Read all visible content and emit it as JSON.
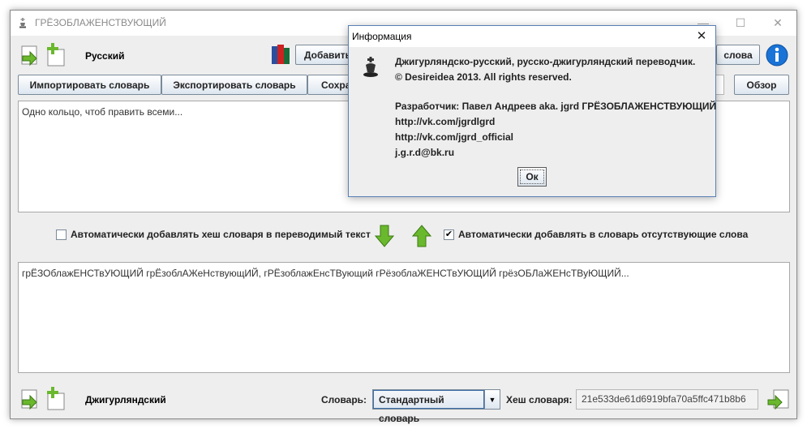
{
  "window": {
    "title": "ГРЁЗОБЛАЖЕНСТВУЮЩИЙ",
    "min_glyph": "—",
    "max_glyph": "☐",
    "close_glyph": "✕"
  },
  "top": {
    "source_language": "Русский",
    "add_button_label": "Добавить",
    "words_button_label": "слова",
    "import_label": "Импортировать словарь",
    "export_label": "Экспортировать словарь",
    "save_label": "Сохра",
    "browse_label": "Обзор"
  },
  "source_text": "Одно кольцо, чтоб править всеми...",
  "middle": {
    "auto_hash_label": "Автоматически добавлять хеш словаря в переводимый текст",
    "auto_hash_checked": false,
    "auto_add_label": "Автоматически добавлять в словарь отсутствующие слова",
    "auto_add_checked": true,
    "check_mark": "✔"
  },
  "target_text": "грЁЗОблажЕНСТвУЮЩИЙ грЁзоблАЖеНствующИЙ, гРЁзоблажЕнсТВующий гРёзоблаЖЕНСТвУЮЩИЙ грёзОБЛаЖЕНсТВуЮЩИЙ...",
  "bottom": {
    "target_language": "Джигурляндский",
    "dictionary_label": "Словарь:",
    "dictionary_selected": "Стандартный словарь",
    "hash_label": "Хеш словаря:",
    "hash_value": "21e533de61d6919bfa70a5ffc471b8b6"
  },
  "dialog": {
    "title": "Информация",
    "close_glyph": "✕",
    "line1": "Джигурляндско-русский, русско-джигурляндский переводчик.",
    "line2": "© Desireidea 2013. All rights reserved.",
    "line3": "Разработчик: Павел Андреев aka. jgrd ГРЁЗОБЛАЖЕНСТВУЮЩИЙ",
    "line4": "http://vk.com/jgrdlgrd",
    "line5": "http://vk.com/jgrd_official",
    "line6": "j.g.r.d@bk.ru",
    "ok_label": "Ок"
  },
  "colors": {
    "accent": "#3d6fa8",
    "info_icon": "#1a73d6",
    "arrow_green": "#6ab82d"
  }
}
